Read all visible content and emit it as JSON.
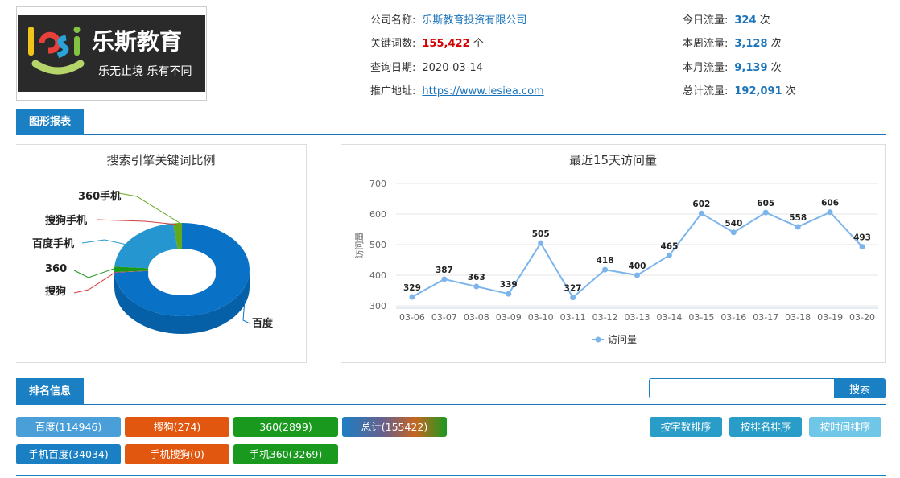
{
  "logo": {
    "brand_letters": "lesi",
    "brand_cn": "乐斯教育",
    "slogan": "乐无止境  乐有不同"
  },
  "info": {
    "company": {
      "label": "公司名称:",
      "value": "乐斯教育投资有限公司"
    },
    "keywords": {
      "label": "关键词数:",
      "value": "155,422",
      "unit": "个"
    },
    "query_date": {
      "label": "查询日期:",
      "value": "2020-03-14"
    },
    "promo_url": {
      "label": "推广地址:",
      "value": "https://www.lesiea.com"
    },
    "today": {
      "label": "今日流量:",
      "value": "324",
      "unit": "次"
    },
    "week": {
      "label": "本周流量:",
      "value": "3,128",
      "unit": "次"
    },
    "month": {
      "label": "本月流量:",
      "value": "9,139",
      "unit": "次"
    },
    "total": {
      "label": "总计流量:",
      "value": "192,091",
      "unit": "次"
    }
  },
  "sections": {
    "chart_report": "图形报表",
    "ranking": "排名信息"
  },
  "chart_data": [
    {
      "type": "pie",
      "title": "搜索引擎关键词比例",
      "labels": [
        "百度",
        "搜狗",
        "360",
        "百度手机",
        "搜狗手机",
        "360手机"
      ],
      "values": [
        114946,
        274,
        2899,
        34034,
        0,
        3269
      ],
      "colors": [
        "#0a72c6",
        "#e0393e",
        "#1a9a1a",
        "#2596cf",
        "#d43f3f",
        "#62a91e"
      ]
    },
    {
      "type": "line",
      "title": "最近15天访问量",
      "ylabel": "访问量",
      "x": [
        "03-06",
        "03-07",
        "03-08",
        "03-09",
        "03-10",
        "03-11",
        "03-12",
        "03-13",
        "03-14",
        "03-15",
        "03-16",
        "03-17",
        "03-18",
        "03-19",
        "03-20"
      ],
      "series": [
        {
          "name": "访问量",
          "values": [
            329,
            387,
            363,
            339,
            505,
            327,
            418,
            400,
            465,
            602,
            540,
            605,
            558,
            606,
            493
          ]
        }
      ],
      "yticks": [
        300,
        400,
        500,
        600,
        700
      ],
      "ylim": [
        300,
        700
      ],
      "color": "#7cb5ec"
    }
  ],
  "search": {
    "placeholder": "",
    "button": "搜索"
  },
  "badges": [
    {
      "label": "百度(114946)",
      "color": "#4a9fd8"
    },
    {
      "label": "搜狗(274)",
      "color": "#e2570f"
    },
    {
      "label": "360(2899)",
      "color": "#199a1f"
    },
    {
      "label": "总计(155422)",
      "color": "gradient"
    },
    {
      "label": "手机百度(34034)",
      "color": "#1b7fc4"
    },
    {
      "label": "手机搜狗(0)",
      "color": "#e2570f"
    },
    {
      "label": "手机360(3269)",
      "color": "#199a1f"
    }
  ],
  "sort_buttons": [
    {
      "label": "按字数排序",
      "color": "#2a9cc8"
    },
    {
      "label": "按排名排序",
      "color": "#2a9cc8"
    },
    {
      "label": "按时间排序",
      "color": "#6fc6e6"
    }
  ]
}
